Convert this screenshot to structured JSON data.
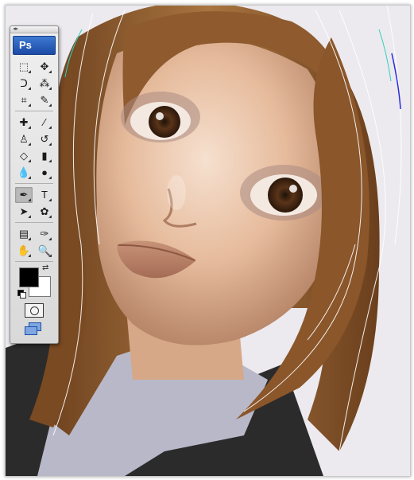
{
  "app": {
    "logo_text": "Ps",
    "grip_text": "◂▸"
  },
  "toolbar": {
    "rows": [
      [
        {
          "name": "marquee-tool-icon",
          "glyph": "⬚"
        },
        {
          "name": "move-tool-icon",
          "glyph": "✥"
        }
      ],
      [
        {
          "name": "lasso-tool-icon",
          "glyph": "ᑐ"
        },
        {
          "name": "magic-wand-tool-icon",
          "glyph": "⁂"
        }
      ],
      [
        {
          "name": "crop-tool-icon",
          "glyph": "⌗"
        },
        {
          "name": "eyedropper-slice-tool-icon",
          "glyph": "✎"
        }
      ],
      [
        {
          "name": "healing-brush-tool-icon",
          "glyph": "✚"
        },
        {
          "name": "brush-tool-icon",
          "glyph": "∕"
        }
      ],
      [
        {
          "name": "clone-stamp-tool-icon",
          "glyph": "♙"
        },
        {
          "name": "history-brush-tool-icon",
          "glyph": "↺"
        }
      ],
      [
        {
          "name": "eraser-tool-icon",
          "glyph": "◇"
        },
        {
          "name": "gradient-tool-icon",
          "glyph": "▮"
        }
      ],
      [
        {
          "name": "blur-tool-icon",
          "glyph": "💧"
        },
        {
          "name": "dodge-tool-icon",
          "glyph": "●"
        }
      ],
      [
        {
          "name": "pen-tool-icon",
          "glyph": "✒",
          "active": true
        },
        {
          "name": "type-tool-icon",
          "glyph": "T"
        }
      ],
      [
        {
          "name": "path-selection-tool-icon",
          "glyph": "➤"
        },
        {
          "name": "custom-shape-tool-icon",
          "glyph": "✿"
        }
      ],
      [
        {
          "name": "notes-tool-icon",
          "glyph": "▤"
        },
        {
          "name": "eyedropper-tool-icon",
          "glyph": "✑"
        }
      ],
      [
        {
          "name": "hand-tool-icon",
          "glyph": "✋"
        },
        {
          "name": "zoom-tool-icon",
          "glyph": "🔍"
        }
      ]
    ]
  },
  "colors": {
    "foreground": "#000000",
    "background": "#ffffff"
  },
  "canvas": {
    "colors": {
      "hair": "#7a4a22",
      "hair_light": "#b07a48",
      "skin": "#e7c0a2",
      "shirt": "#b8b8c8",
      "vest": "#2b2b2b",
      "backdrop": "#eceaee"
    }
  }
}
